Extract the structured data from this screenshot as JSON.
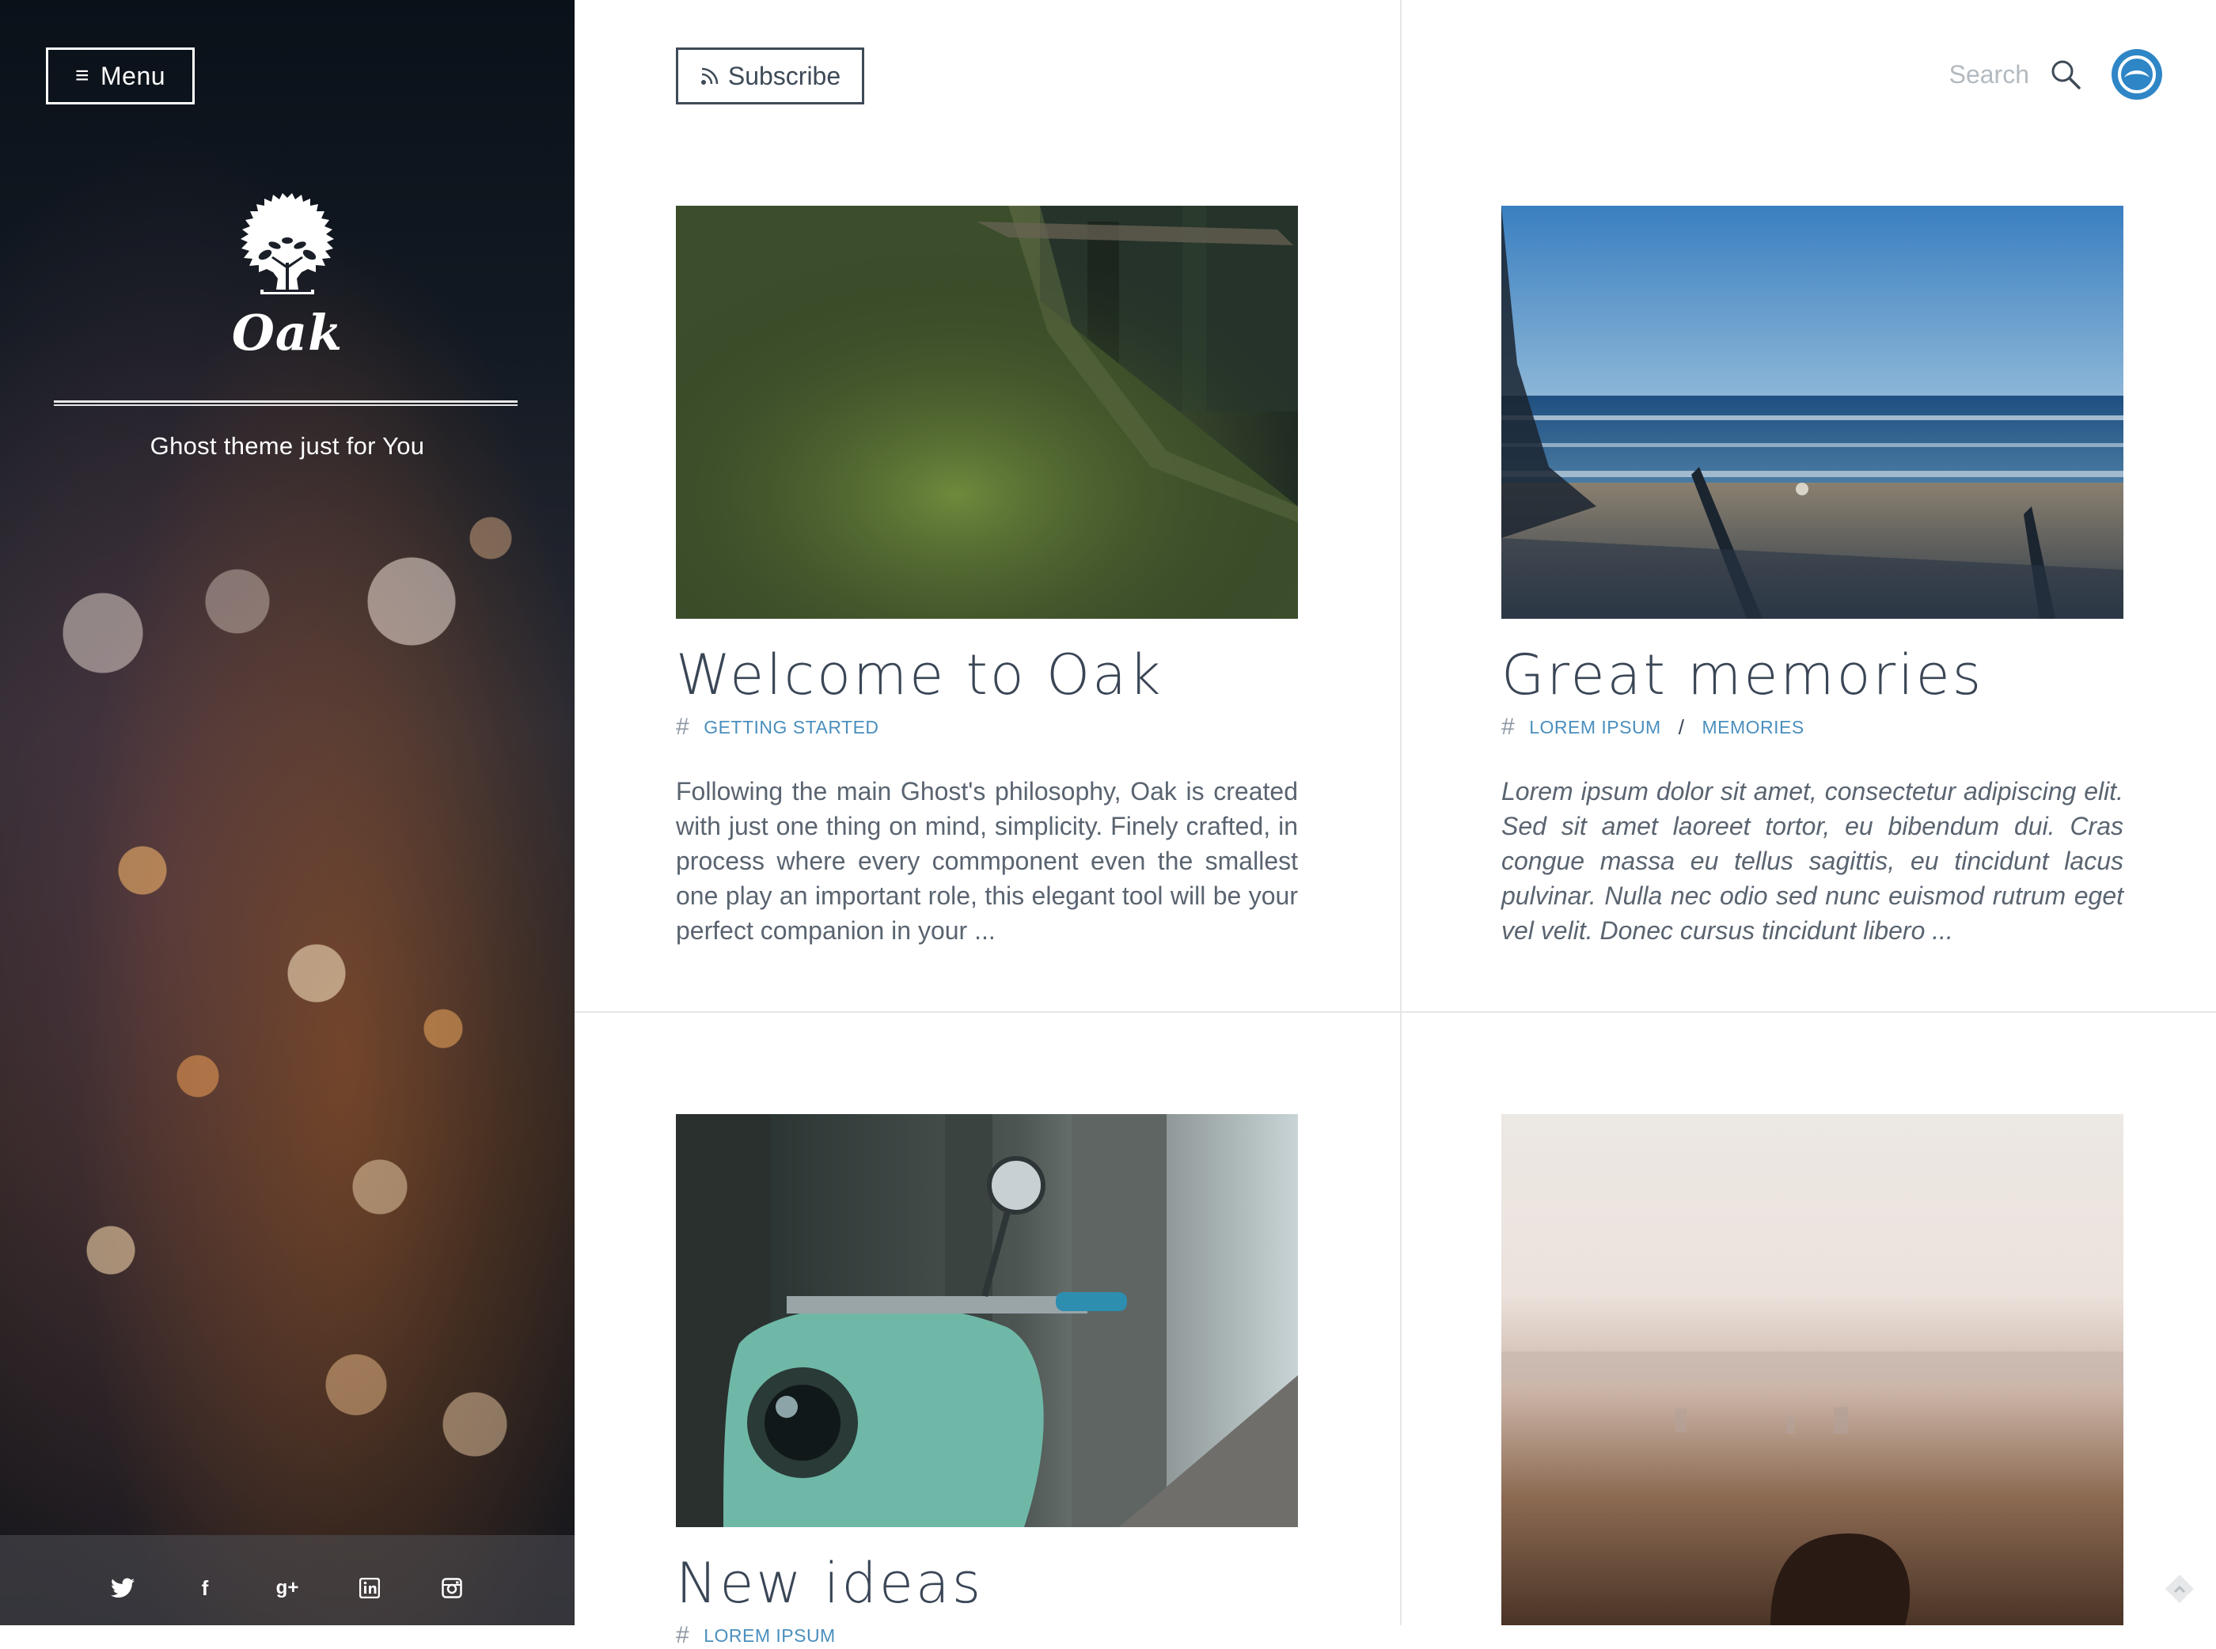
{
  "sidebar": {
    "menu_label": "Menu",
    "logo_text": "Oak",
    "tagline": "Ghost theme just for You",
    "social": [
      {
        "icon": "twitter-icon",
        "glyph": ""
      },
      {
        "icon": "facebook-icon",
        "glyph": "f"
      },
      {
        "icon": "google-plus-icon",
        "glyph": "g+"
      },
      {
        "icon": "linkedin-icon",
        "glyph": "in"
      },
      {
        "icon": "instagram-icon",
        "glyph": ""
      }
    ]
  },
  "header": {
    "subscribe_label": "Subscribe",
    "search_placeholder": "Search"
  },
  "posts": [
    {
      "title": "Welcome to Oak",
      "tags": [
        "GETTING STARTED"
      ],
      "excerpt": "Following the main Ghost's philosophy, Oak is created with just one thing on mind, simplicity. Finely crafted, in process where every commponent even the smallest one play an important role, this elegant tool will be your perfect companion in your ...",
      "image": "mossy-tree-photo"
    },
    {
      "title": "Great memories",
      "tags": [
        "LOREM IPSUM",
        "MEMORIES"
      ],
      "tag_separator": "/",
      "excerpt": "Lorem ipsum dolor sit amet, consectetur adipiscing elit. Sed sit amet laoreet tortor, eu bibendum dui. Cras congue massa eu tellus sagittis, eu tincidunt lacus pulvinar. Nulla nec odio sed nunc euismod rutrum eget vel velit. Donec cursus tincidunt libero ...",
      "image": "beach-photo"
    },
    {
      "title": "New ideas",
      "tags": [
        "LOREM IPSUM"
      ],
      "image": "scooter-photo"
    },
    {
      "image": "hazy-landscape-photo"
    }
  ],
  "colors": {
    "accent": "#2e86c6",
    "tag_link": "#4a8fbd",
    "title": "#3a4656",
    "text": "#5a6470"
  }
}
